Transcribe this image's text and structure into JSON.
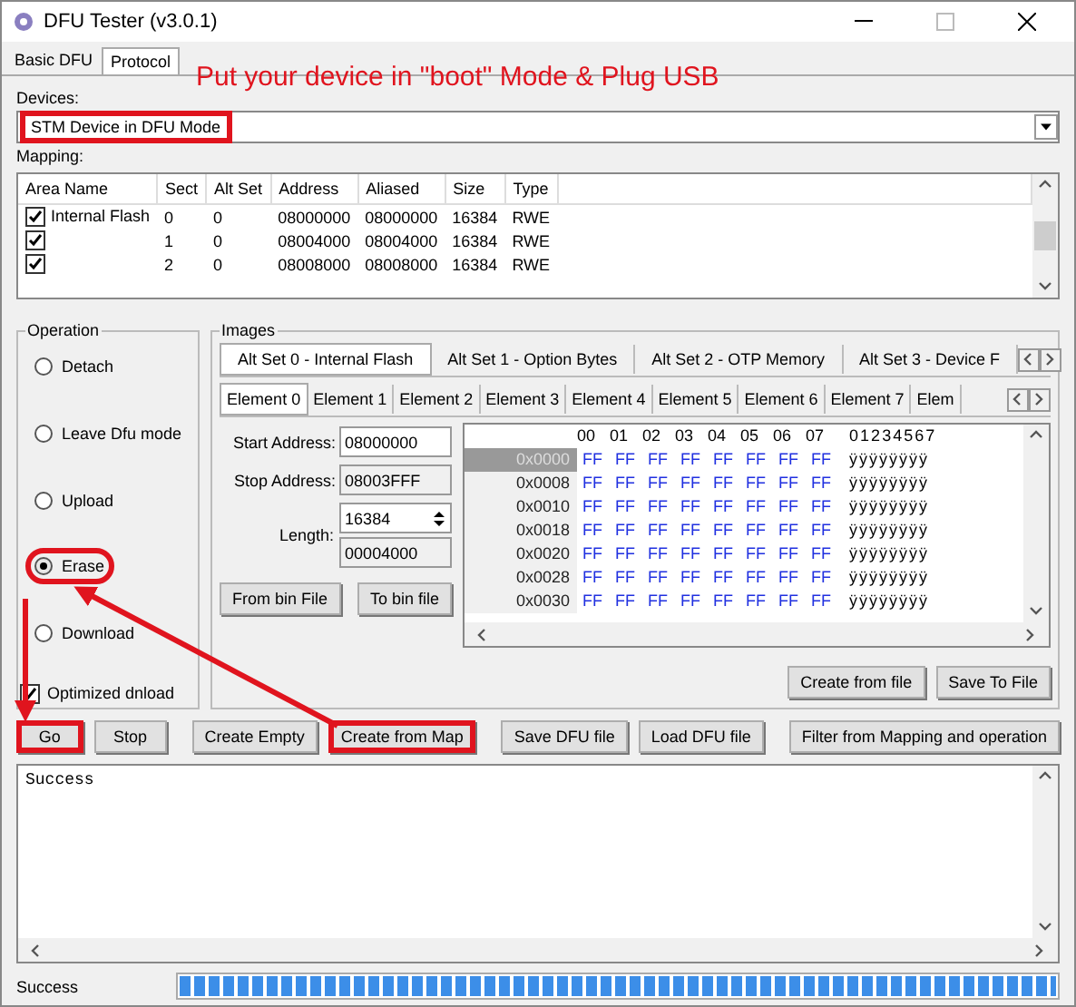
{
  "window": {
    "title": "DFU Tester (v3.0.1)"
  },
  "tabs": [
    {
      "label": "Basic DFU",
      "selected": false
    },
    {
      "label": "Protocol",
      "selected": true
    }
  ],
  "annotation": "Put your device in \"boot\" Mode & Plug USB",
  "devices": {
    "label": "Devices:",
    "value": "STM Device in DFU Mode",
    "highlighted": true
  },
  "mapping": {
    "label": "Mapping:",
    "columns": [
      "Area Name",
      "Sect",
      "Alt Set",
      "Address",
      "Aliased",
      "Size",
      "Type"
    ],
    "rows": [
      {
        "checked": true,
        "cells": [
          "Internal Flash",
          "0",
          "0",
          "08000000",
          "08000000",
          "16384",
          "RWE"
        ]
      },
      {
        "checked": true,
        "cells": [
          "",
          "1",
          "0",
          "08004000",
          "08004000",
          "16384",
          "RWE"
        ]
      },
      {
        "checked": true,
        "cells": [
          "",
          "2",
          "0",
          "08008000",
          "08008000",
          "16384",
          "RWE"
        ]
      }
    ]
  },
  "operation": {
    "label": "Operation",
    "options": [
      {
        "label": "Detach",
        "selected": false,
        "highlighted": false
      },
      {
        "label": "Leave Dfu mode",
        "selected": false,
        "highlighted": false
      },
      {
        "label": "Upload",
        "selected": false,
        "highlighted": false
      },
      {
        "label": "Erase",
        "selected": true,
        "highlighted": true
      },
      {
        "label": "Download",
        "selected": false,
        "highlighted": false
      }
    ],
    "optimized": {
      "label": "Optimized dnload",
      "checked": true
    }
  },
  "images": {
    "label": "Images",
    "alt_tabs": [
      {
        "label": "Alt Set 0 - Internal Flash",
        "selected": true
      },
      {
        "label": "Alt Set 1 - Option Bytes",
        "selected": false
      },
      {
        "label": "Alt Set 2 - OTP Memory",
        "selected": false
      },
      {
        "label": "Alt Set 3 - Device F",
        "selected": false
      }
    ],
    "element_tabs": [
      {
        "label": "Element 0",
        "selected": true
      },
      {
        "label": "Element 1",
        "selected": false
      },
      {
        "label": "Element 2",
        "selected": false
      },
      {
        "label": "Element 3",
        "selected": false
      },
      {
        "label": "Element 4",
        "selected": false
      },
      {
        "label": "Element 5",
        "selected": false
      },
      {
        "label": "Element 6",
        "selected": false
      },
      {
        "label": "Element 7",
        "selected": false
      },
      {
        "label": "Elem",
        "selected": false
      }
    ],
    "start_address": {
      "label": "Start Address:",
      "value": "08000000"
    },
    "stop_address": {
      "label": "Stop Address:",
      "value": "08003FFF"
    },
    "length": {
      "label": "Length:",
      "value": "16384",
      "hex": "00004000"
    },
    "bin_buttons": [
      "From bin File",
      "To bin file"
    ],
    "hex": {
      "columns": [
        "00",
        "01",
        "02",
        "03",
        "04",
        "05",
        "06",
        "07"
      ],
      "ascii_header": "01234567",
      "rows": [
        {
          "offset": "0x0000",
          "selected": true,
          "bytes": [
            "FF",
            "FF",
            "FF",
            "FF",
            "FF",
            "FF",
            "FF",
            "FF"
          ],
          "ascii": "ÿÿÿÿÿÿÿÿ"
        },
        {
          "offset": "0x0008",
          "selected": false,
          "bytes": [
            "FF",
            "FF",
            "FF",
            "FF",
            "FF",
            "FF",
            "FF",
            "FF"
          ],
          "ascii": "ÿÿÿÿÿÿÿÿ"
        },
        {
          "offset": "0x0010",
          "selected": false,
          "bytes": [
            "FF",
            "FF",
            "FF",
            "FF",
            "FF",
            "FF",
            "FF",
            "FF"
          ],
          "ascii": "ÿÿÿÿÿÿÿÿ"
        },
        {
          "offset": "0x0018",
          "selected": false,
          "bytes": [
            "FF",
            "FF",
            "FF",
            "FF",
            "FF",
            "FF",
            "FF",
            "FF"
          ],
          "ascii": "ÿÿÿÿÿÿÿÿ"
        },
        {
          "offset": "0x0020",
          "selected": false,
          "bytes": [
            "FF",
            "FF",
            "FF",
            "FF",
            "FF",
            "FF",
            "FF",
            "FF"
          ],
          "ascii": "ÿÿÿÿÿÿÿÿ"
        },
        {
          "offset": "0x0028",
          "selected": false,
          "bytes": [
            "FF",
            "FF",
            "FF",
            "FF",
            "FF",
            "FF",
            "FF",
            "FF"
          ],
          "ascii": "ÿÿÿÿÿÿÿÿ"
        },
        {
          "offset": "0x0030",
          "selected": false,
          "bytes": [
            "FF",
            "FF",
            "FF",
            "FF",
            "FF",
            "FF",
            "FF",
            "FF"
          ],
          "ascii": "ÿÿÿÿÿÿÿÿ"
        }
      ]
    },
    "file_buttons": [
      "Create from file",
      "Save To File"
    ]
  },
  "actions": [
    {
      "label": "Go",
      "highlighted": true
    },
    {
      "label": "Stop",
      "highlighted": false
    },
    {
      "label": "Create Empty",
      "highlighted": false
    },
    {
      "label": "Create from Map",
      "highlighted": true
    },
    {
      "label": "Save DFU file",
      "highlighted": false
    },
    {
      "label": "Load DFU file",
      "highlighted": false
    },
    {
      "label": "Filter from Mapping and operation",
      "highlighted": false
    }
  ],
  "log": [
    "Success"
  ],
  "status": {
    "text": "Success",
    "level": 1
  }
}
